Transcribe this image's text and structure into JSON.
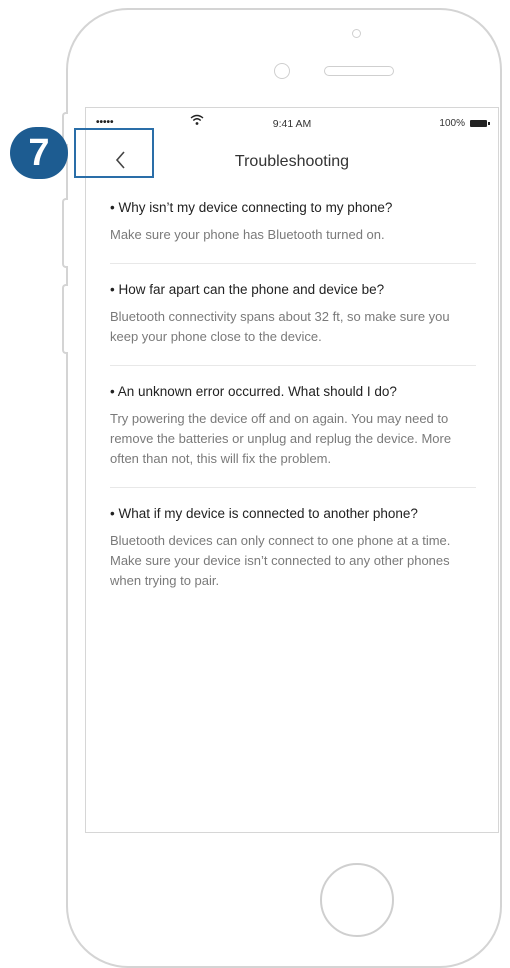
{
  "status_bar": {
    "signal": "•••••",
    "time": "9:41 AM",
    "battery_percent": "100%"
  },
  "nav": {
    "back_icon": "chevron-left-icon",
    "back_glyph": "<",
    "title": "Troubleshooting"
  },
  "faq": [
    {
      "question": "• Why isn’t my device connecting to my phone?",
      "answer": "Make sure your phone has Bluetooth turned on."
    },
    {
      "question": "• How far apart can the phone and device be?",
      "answer": "Bluetooth connectivity spans about 32 ft, so make sure you keep your phone close to the device."
    },
    {
      "question": "• An unknown error occurred. What should I do?",
      "answer": "Try powering the device off and on again. You may need to remove the batteries or unplug and replug the device. More often than not, this will fix the problem."
    },
    {
      "question": "• What if my device is connected to another phone?",
      "answer": "Bluetooth devices can only connect to one phone at a time. Make sure your device isn’t connected to any other phones when trying to pair."
    }
  ],
  "annotation": {
    "step_number": "7",
    "badge_color": "#1d5c91",
    "highlight_color": "#2a6ea8"
  }
}
